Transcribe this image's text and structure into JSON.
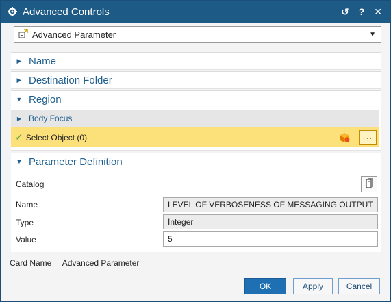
{
  "window": {
    "title": "Advanced Controls",
    "actions": {
      "reset": "↺",
      "help": "?",
      "close": "✕"
    }
  },
  "type_selector": {
    "value": "Advanced Parameter"
  },
  "sections": {
    "name": "Name",
    "destination": "Destination Folder",
    "region": "Region",
    "body_focus": "Body Focus",
    "select_object": "Select Object (0)",
    "parameter_definition": "Parameter Definition"
  },
  "params": {
    "catalog_label": "Catalog",
    "name_label": "Name",
    "name_value": "LEVEL OF VERBOSENESS OF MESSAGING OUTPUT",
    "type_label": "Type",
    "type_value": "Integer",
    "value_label": "Value",
    "value_value": "5"
  },
  "footer": {
    "card_name_label": "Card Name",
    "card_name_value": "Advanced Parameter"
  },
  "buttons": {
    "ok": "OK",
    "apply": "Apply",
    "cancel": "Cancel"
  },
  "colors": {
    "titlebar": "#1d5a86",
    "section_text": "#1f5f8f",
    "highlight": "#fce07a"
  }
}
